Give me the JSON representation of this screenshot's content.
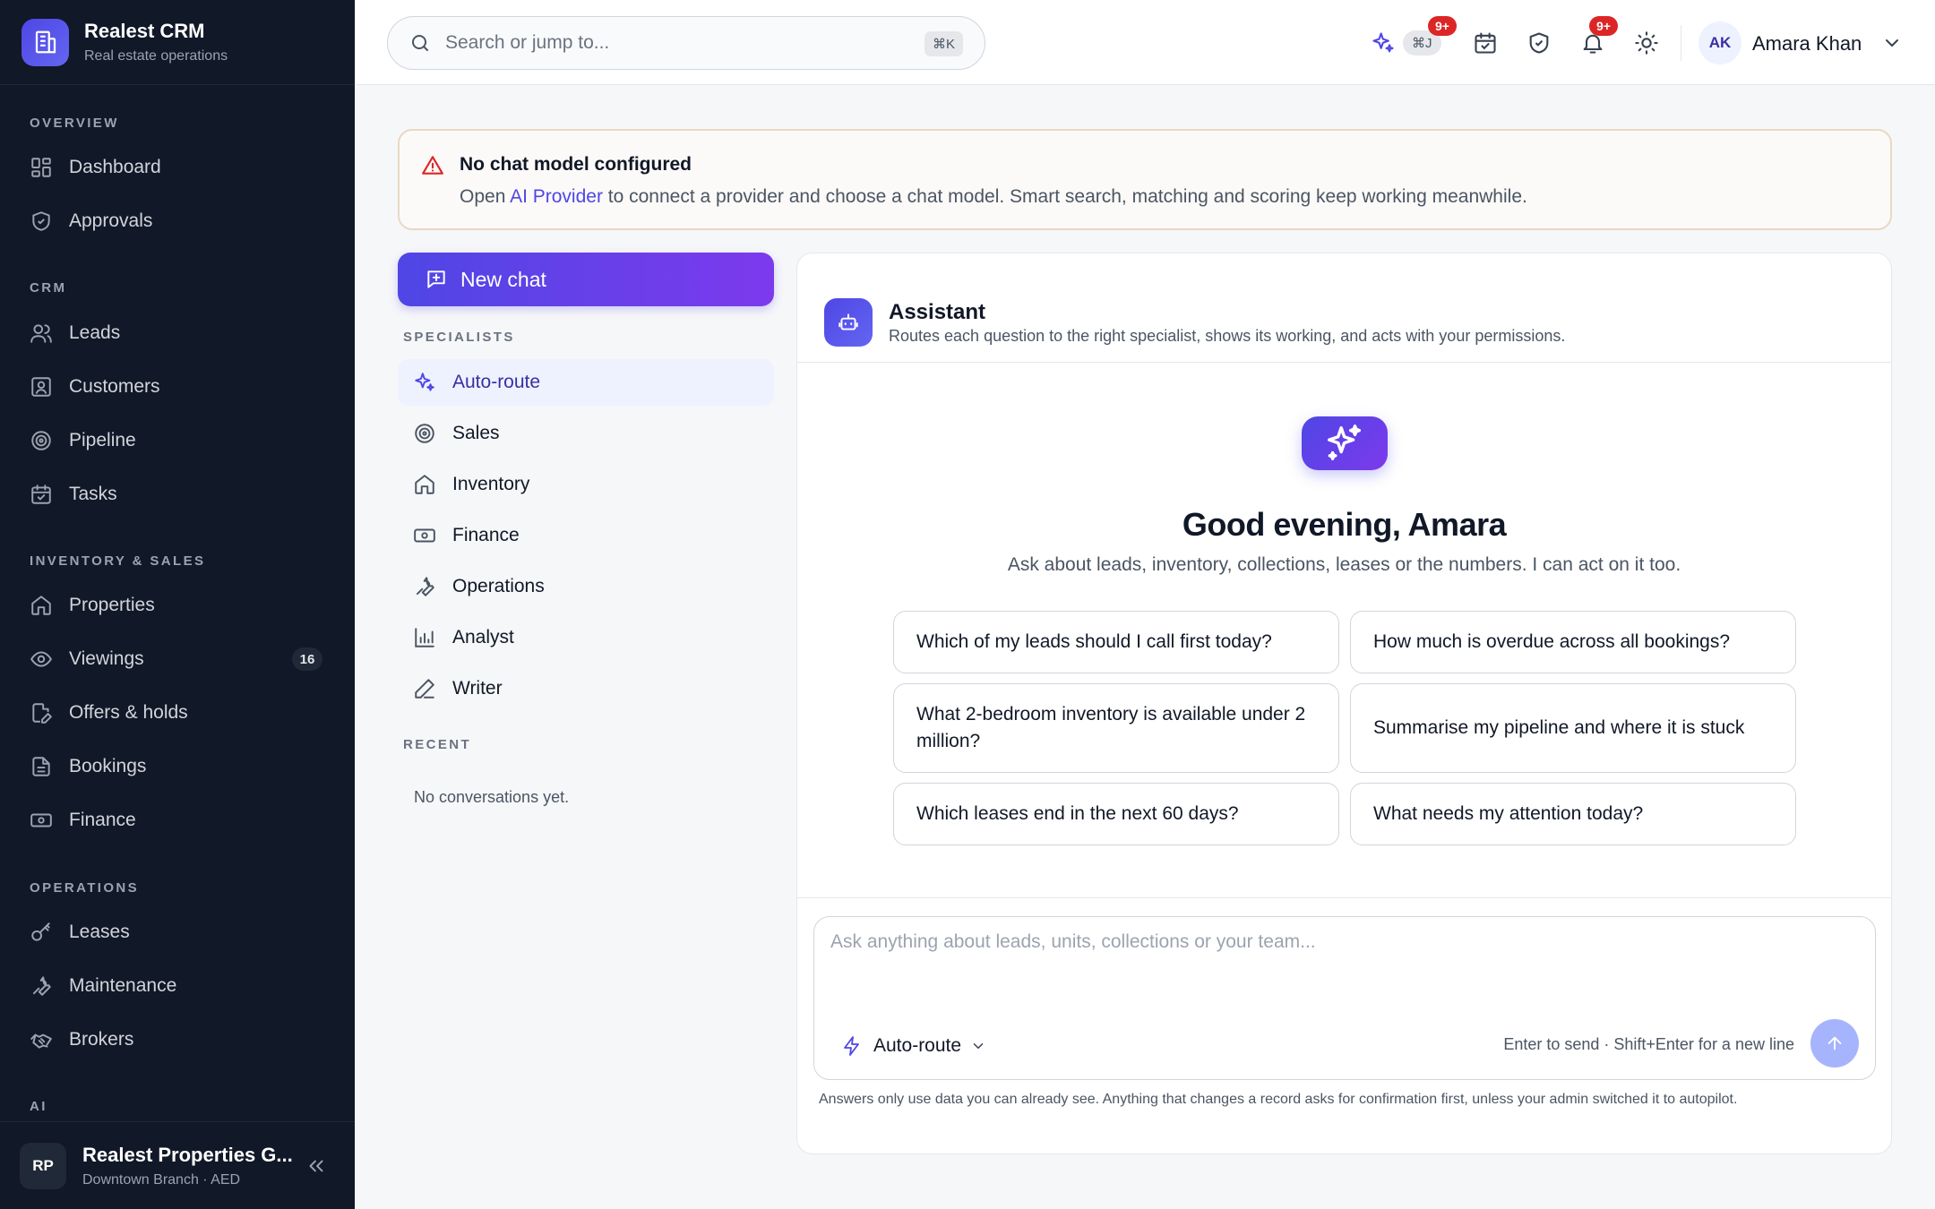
{
  "brand": {
    "name": "Realest CRM",
    "subtitle": "Real estate operations"
  },
  "sidebar": {
    "sections": [
      {
        "title": "OVERVIEW"
      },
      {
        "title": "CRM"
      },
      {
        "title": "INVENTORY & SALES"
      },
      {
        "title": "OPERATIONS"
      },
      {
        "title": "AI"
      }
    ],
    "items": [
      {
        "label": "Dashboard",
        "icon": "grid-icon"
      },
      {
        "label": "Approvals",
        "icon": "shield-check-icon"
      },
      {
        "label": "Leads",
        "icon": "users-icon"
      },
      {
        "label": "Customers",
        "icon": "contact-icon"
      },
      {
        "label": "Pipeline",
        "icon": "target-icon"
      },
      {
        "label": "Tasks",
        "icon": "calendar-check-icon"
      },
      {
        "label": "Properties",
        "icon": "home-icon"
      },
      {
        "label": "Viewings",
        "icon": "eye-icon",
        "badge": "16"
      },
      {
        "label": "Offers & holds",
        "icon": "file-edit-icon"
      },
      {
        "label": "Bookings",
        "icon": "document-icon"
      },
      {
        "label": "Finance",
        "icon": "banknote-icon"
      },
      {
        "label": "Leases",
        "icon": "key-icon"
      },
      {
        "label": "Maintenance",
        "icon": "wrench-icon"
      },
      {
        "label": "Brokers",
        "icon": "handshake-icon"
      }
    ],
    "org": {
      "initials": "RP",
      "name": "Realest Properties G...",
      "subtitle": "Downtown Branch · AED"
    }
  },
  "topbar": {
    "search_placeholder": "Search or jump to...",
    "search_shortcut": "⌘K",
    "ai_shortcut": "⌘J",
    "ai_badge": "9+",
    "notifications_badge": "9+",
    "user": {
      "initials": "AK",
      "name": "Amara Khan"
    }
  },
  "alert": {
    "title": "No chat model configured",
    "body_prefix": "Open ",
    "link": "AI Provider",
    "body_suffix": " to connect a provider and choose a chat model. Smart search, matching and scoring keep working meanwhile."
  },
  "chat_nav": {
    "new_chat": "New chat",
    "specialists_title": "SPECIALISTS",
    "specialists": [
      {
        "label": "Auto-route",
        "icon": "sparkles-icon",
        "active": true
      },
      {
        "label": "Sales",
        "icon": "target-icon"
      },
      {
        "label": "Inventory",
        "icon": "home-icon"
      },
      {
        "label": "Finance",
        "icon": "banknote-icon"
      },
      {
        "label": "Operations",
        "icon": "wrench-icon"
      },
      {
        "label": "Analyst",
        "icon": "bar-chart-icon"
      },
      {
        "label": "Writer",
        "icon": "pen-icon"
      }
    ],
    "recent_title": "RECENT",
    "recent_empty": "No conversations yet."
  },
  "assistant": {
    "title": "Assistant",
    "subtitle": "Routes each question to the right specialist, shows its working, and acts with your permissions.",
    "greeting": "Good evening, Amara",
    "tagline": "Ask about leads, inventory, collections, leases or the numbers. I can act on it too.",
    "prompts": [
      "Which of my leads should I call first today?",
      "How much is overdue across all bookings?",
      "What 2-bedroom inventory is available under 2 million?",
      "Summarise my pipeline and where it is stuck",
      "Which leases end in the next 60 days?",
      "What needs my attention today?"
    ],
    "composer_placeholder": "Ask anything about leads, units, collections or your team...",
    "route_label": "Auto-route",
    "hint": "Enter to send · Shift+Enter for a new line",
    "disclaimer": "Answers only use data you can already see. Anything that changes a record asks for confirmation first, unless your admin switched it to autopilot."
  },
  "colors": {
    "sidebar_bg": "#111827",
    "accent": "#4f46e5",
    "accent_purple": "#7c3aed",
    "badge_red": "#dc2626",
    "alert_border": "#e7d9c4"
  }
}
